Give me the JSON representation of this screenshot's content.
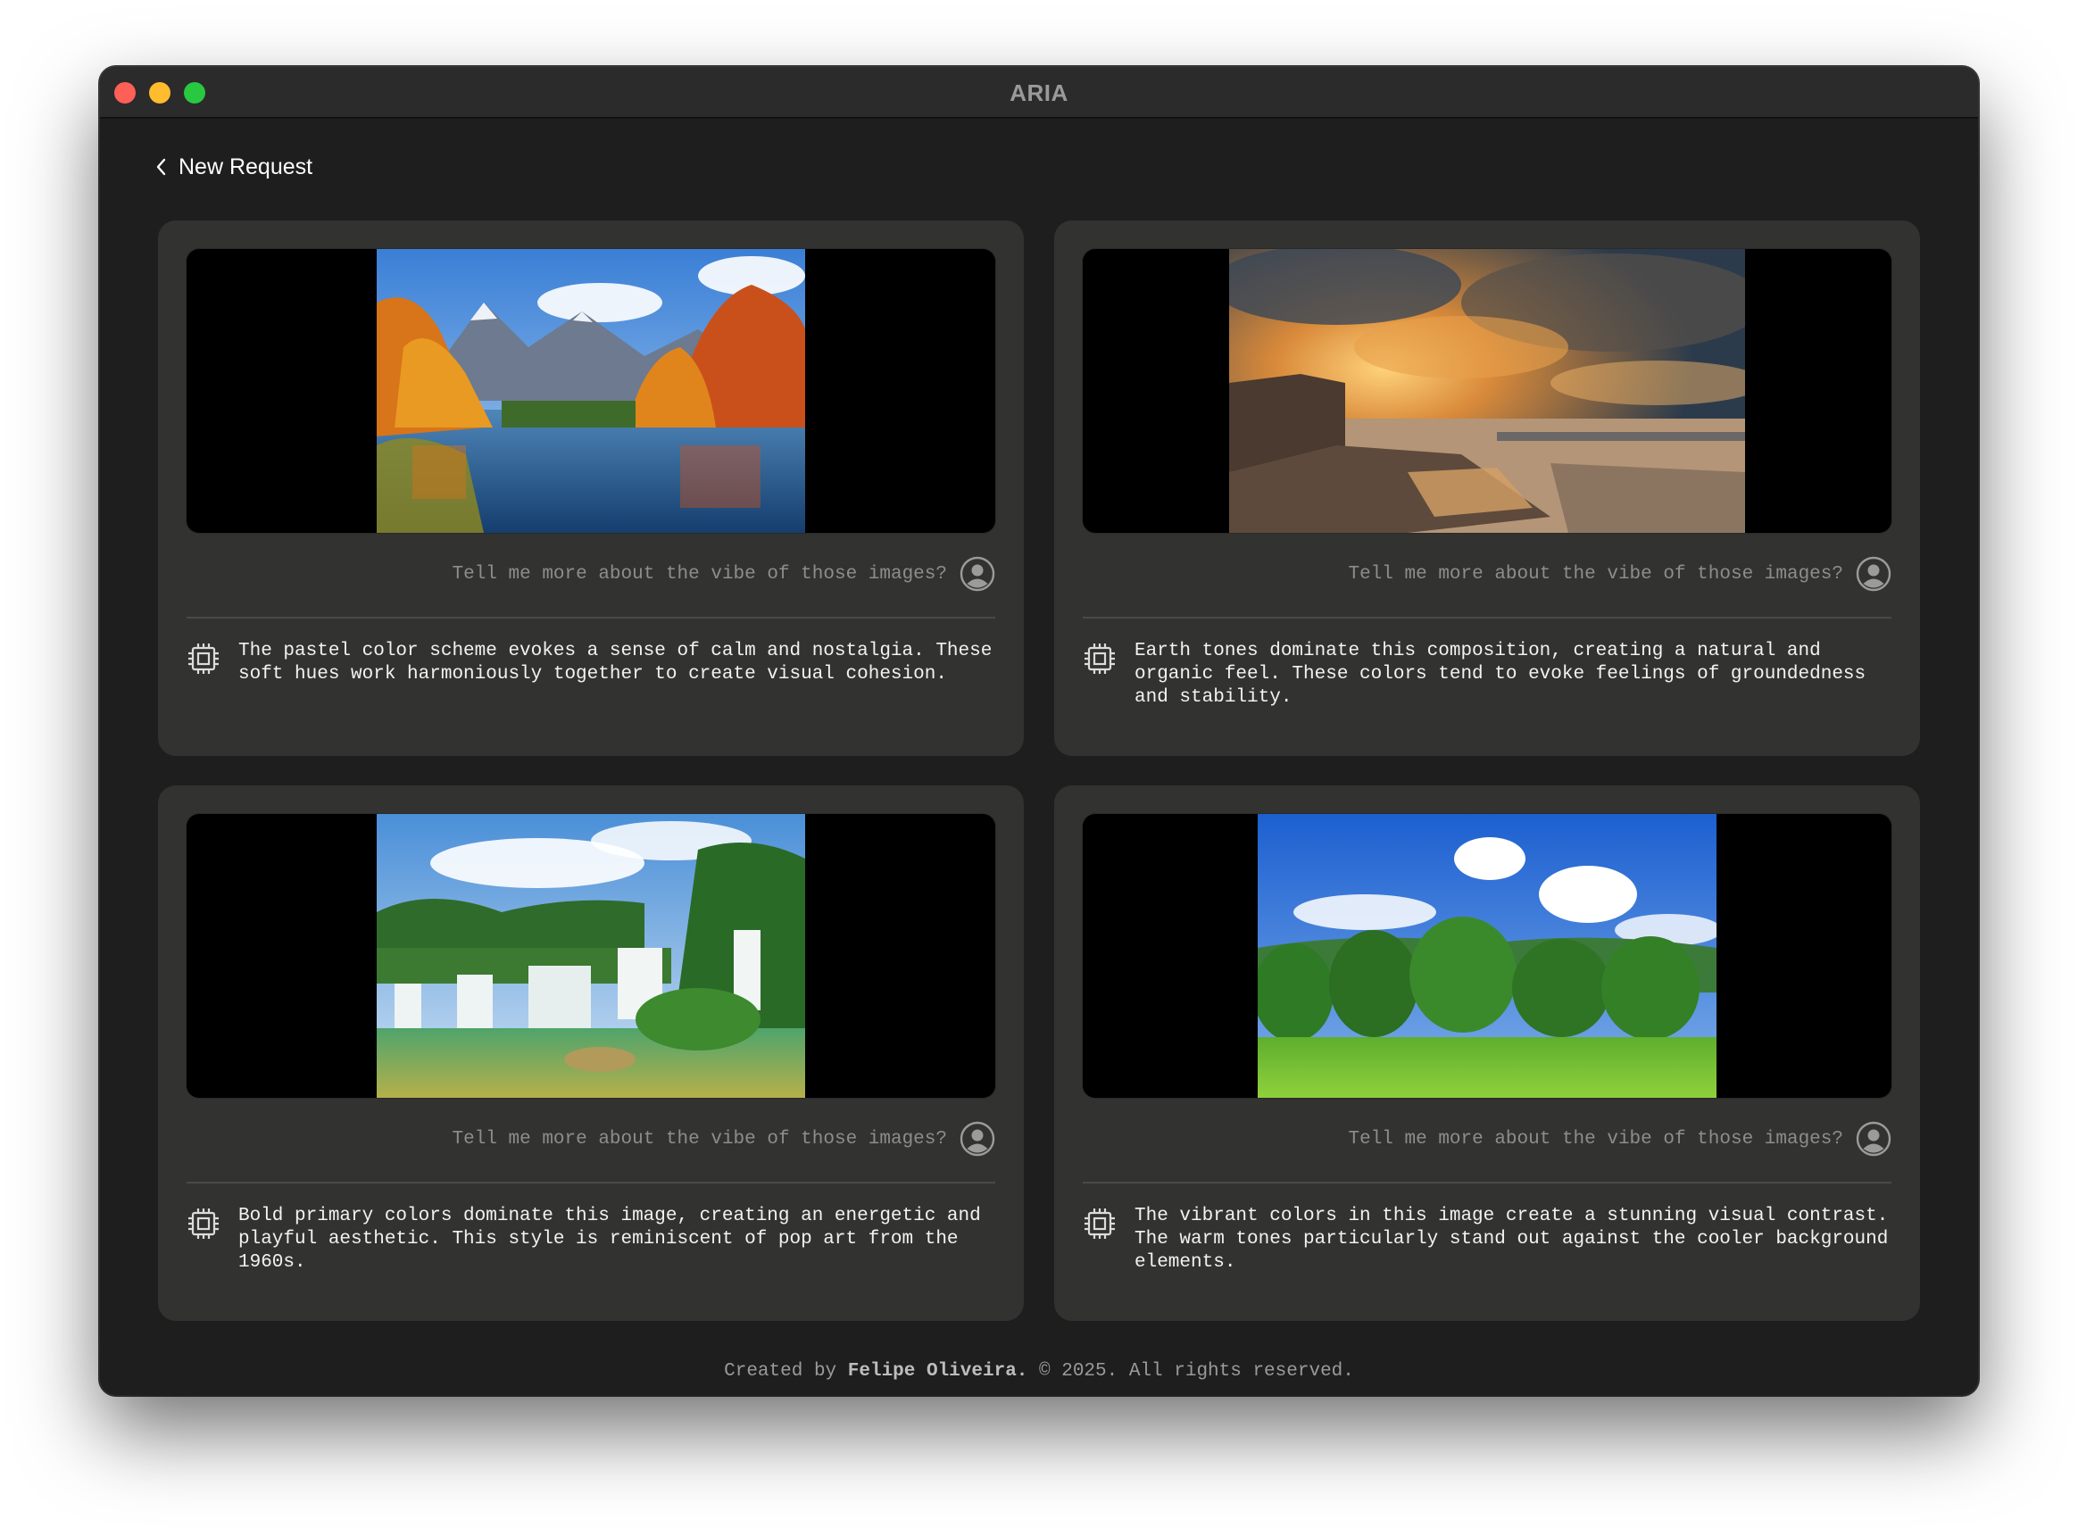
{
  "window": {
    "title": "ARIA"
  },
  "nav": {
    "back_label": "New Request"
  },
  "cards": [
    {
      "image": "autumn-mountain-lake-photo",
      "prompt": "Tell me more about the vibe of those images?",
      "response": "The pastel color scheme evokes a sense of calm and nostalgia. These\nsoft hues work harmoniously together to create visual cohesion."
    },
    {
      "image": "sunset-rocky-coast-photo",
      "prompt": "Tell me more about the vibe of those images?",
      "response": "Earth tones dominate this composition, creating a natural and\norganic feel. These colors tend to evoke feelings of groundedness\nand stability."
    },
    {
      "image": "tropical-waterfall-photo",
      "prompt": "Tell me more about the vibe of those images?",
      "response": "Bold primary colors dominate this image, creating an energetic and\nplayful aesthetic. This style is reminiscent of pop art from the\n1960s."
    },
    {
      "image": "green-forest-meadow-photo",
      "prompt": "Tell me more about the vibe of those images?",
      "response": "The vibrant colors in this image create a stunning visual contrast.\nThe warm tones particularly stand out against the cooler background\nelements."
    }
  ],
  "footer": {
    "prefix": "Created by",
    "author": "Felipe Oliveira.",
    "suffix": "© 2025. All rights reserved."
  },
  "icons": {
    "user": "user-avatar-icon",
    "assistant": "cpu-chip-icon",
    "back": "chevron-left-icon"
  },
  "colors": {
    "window_bg": "#1e1e1e",
    "card_bg": "#323230",
    "prompt_text": "#8d8d8a",
    "response_text": "#f2f2f2"
  }
}
